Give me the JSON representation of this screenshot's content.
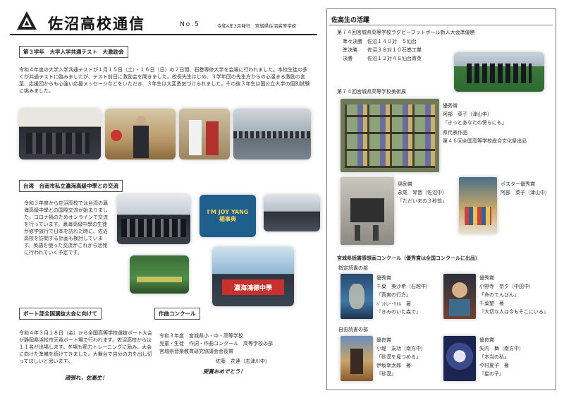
{
  "header": {
    "title": "佐沼高校通信",
    "issue": "No.5",
    "date_issuer": "令和4年3月発行　宮城県佐沼高等学校"
  },
  "section_exam": {
    "title": "第３学年　大学入学共通テスト　大激励会",
    "body": "令和４年度の大学入学共通テストが１月１５日（土）・１６日（日）の２日間、石巻専修大学を会場に行われました。本校生徒の多くが共通テストに臨みましたが、テスト前日に激励会を開きました。校長先生はじめ、３学年団の先生方からの心温まる激励の言葉、応援団からも心強い応援メッセージなどをいただき、３年生は大変勇気づけられました。その後３年生は国公立大学の個別試験に挑みました。"
  },
  "section_taiwan": {
    "title": "台湾　台南市私立瀛海高級中學との交流",
    "body": "令和３年度から佐沼高校では台湾の瀛海高級中學との国際交流が始まりました。コロナ禍のためオンラインで交流を行っています。瀛海高級中學の生徒が修学旅行で日本を訪れた時に、佐沼高校を訪問する計画も検討しています。英語を使った交流がこれから活発に行われていく予定です。",
    "banner_text": "瀛海鴻德中學",
    "slide_text": "I'M JOY YANG 楊事典"
  },
  "section_boat": {
    "title": "ボート部全国選抜大会に向けて",
    "body": "令和４年３月１８日（金）から全国高等学校選抜ボート大会が静岡県浜松市天竜ボート場で行われます。佐沼高校からは１１名が出場します。冬場も筋力トレーニングに励み、大会に向けた準備を続けてきました。大舞台で自分の力を出し切ってほしいと思います。",
    "cheer": "頑張れ，佐高生！"
  },
  "section_composition": {
    "title": "作曲コンクール",
    "lines": [
      "令和３年度　宮城県小・中・高等学校",
      "児童・生徒　作詞・作曲コンクール　高等学校の部",
      "宮城県音楽教育研究協議会会長賞",
      "佐藤　花連（志津川中）"
    ],
    "cheer": "受賞おめでとう！"
  },
  "activities": {
    "title": "佐高生の活躍",
    "rugby": {
      "title": "第７４回宮城県高等学校ラグビーフットボール新人大会準優勝",
      "rows": [
        "準々決勝　佐沼１４０対　５仙台",
        "準決勝　　佐沼３８対１０石巻工業",
        "決勝　　　佐沼１２対４８仙台育英"
      ]
    },
    "art": {
      "title": "第７４回宮城県高等学校美術展",
      "award1": [
        "優秀賞",
        "阿部　菜子（津山中）",
        "「きっとあなたの傍らにも」",
        "県代表作品",
        "第４６回全国高等学校総合文化祭出品"
      ],
      "award2": [
        "奨励賞",
        "永尾　琴音（佐沼中）",
        "「ただいまの３秒前」"
      ],
      "award3": [
        "ポスター優秀賞",
        "阿部　菜子（津山中）"
      ]
    },
    "reading": {
      "title": "宮城県読書感想画コンクール（優秀賞は全国コンクールに出品）",
      "designated_label": "指定読書の部",
      "free_label": "自由読書の部",
      "w1": [
        "優秀賞",
        "千葉　美沙希（石越中）",
        "「真実の行方」",
        "ﾍﾞﾝﾄﾚｰ･ﾘﾄﾙ　著",
        "『きみのいた森で』"
      ],
      "w2": [
        "優秀賞",
        "小野寺　奈夕（中田中）",
        "「命のてんびん」",
        "千葉望　著",
        "『大切な人は今もそこにいる』"
      ],
      "w3": [
        "優良賞",
        "小堤　友功（南方中）",
        "「砂漠を見つめる」",
        "伊坂幸太郎　著",
        "『砂漠』"
      ],
      "w4": [
        "優良賞",
        "矢内　舞（南方中）",
        "「本当の私」",
        "今村夏子　著",
        "『星の子』"
      ]
    }
  }
}
